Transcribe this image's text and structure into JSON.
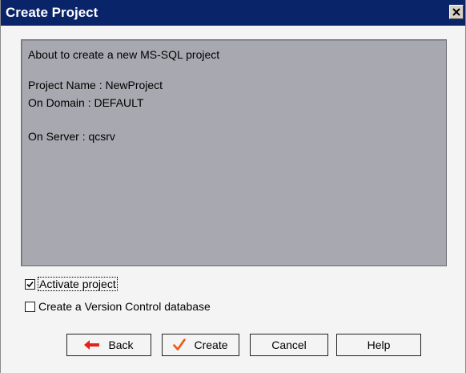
{
  "window": {
    "title": "Create Project",
    "close_icon": "close-icon"
  },
  "info": {
    "line1": "About to create a new MS-SQL project",
    "project_name": "Project Name : NewProject",
    "domain": "On Domain : DEFAULT",
    "server": "On Server : qcsrv"
  },
  "options": {
    "activate_label": "Activate project",
    "activate_checked": true,
    "version_control_label": "Create a Version Control database",
    "version_control_checked": false
  },
  "buttons": {
    "back": "Back",
    "create": "Create",
    "cancel": "Cancel",
    "help": "Help"
  },
  "colors": {
    "titlebar": "#0a246a",
    "panel": "#a8a8b0",
    "back_arrow": "#e0241c",
    "create_check": "#e8581c"
  }
}
